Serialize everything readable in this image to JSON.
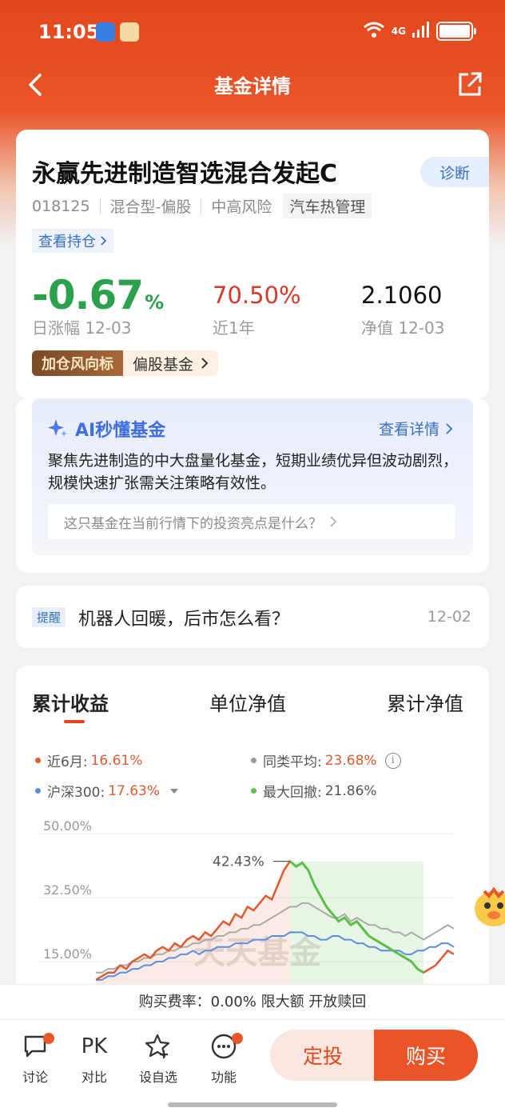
{
  "status_bar": {
    "time": "11:05",
    "network": "4G"
  },
  "nav": {
    "title": "基金详情"
  },
  "fund": {
    "name": "永赢先进制造智选混合发起C",
    "diagnose_label": "诊断",
    "code": "018125",
    "type": "混合型-偏股",
    "risk": "中高风险",
    "theme_tag": "汽车热管理",
    "holdings_link": "查看持仓",
    "daily_change": "-0.67",
    "daily_change_unit": "%",
    "daily_change_label": "日涨幅 12-03",
    "year_return": "70.50%",
    "year_return_label": "近1年",
    "nav_value": "2.1060",
    "nav_label": "净值 12-03",
    "wind_tag": "加仓风向标",
    "wind_tag_value": "偏股基金"
  },
  "ai": {
    "title": "AI秒懂基金",
    "more_label": "查看详情",
    "description": "聚焦先进制造的中大盘量化基金，短期业绩优异但波动剧烈，规模快速扩张需关注策略有效性。",
    "question": "这只基金在当前行情下的投资亮点是什么？"
  },
  "reminder": {
    "tag": "提醒",
    "text": "机器人回暖，后市怎么看？",
    "date": "12-02"
  },
  "tabs": [
    "累计收益",
    "单位净值",
    "累计净值"
  ],
  "legend": {
    "fund_label": "近6月:",
    "fund_value": "16.61%",
    "peer_label": "同类平均:",
    "peer_value": "23.68%",
    "index_label": "沪深300:",
    "index_value": "17.63%",
    "drawdown_label": "最大回撤:",
    "drawdown_value": "21.86%"
  },
  "colors": {
    "brand": "#e4471c",
    "down": "#2aa14a",
    "link": "#3970c8",
    "fund_line": "#e05a2f",
    "peer_line": "#aaaaaa",
    "index_line": "#5b8ee0",
    "drawdown": "#5cbf4a"
  },
  "chart_data": {
    "type": "line",
    "y_tick_labels": [
      "50.00%",
      "32.50%",
      "15.00%"
    ],
    "ylim": [
      15,
      50
    ],
    "peak_annotation": "42.43%",
    "watermark": "天天基金",
    "x": [
      0,
      1,
      2,
      3,
      4,
      5,
      6,
      7,
      8,
      9,
      10,
      11,
      12,
      13,
      14,
      15,
      16,
      17,
      18,
      19,
      20,
      21,
      22,
      23,
      24,
      25,
      26,
      27,
      28,
      29,
      30,
      31,
      32,
      33,
      34,
      35,
      36,
      37,
      38,
      39,
      40,
      41,
      42,
      43,
      44,
      45,
      46,
      47,
      48,
      49,
      50,
      51,
      52,
      53,
      54,
      55,
      56,
      57,
      58,
      59
    ],
    "series": [
      {
        "name": "近6月",
        "values": [
          10,
          11,
          12,
          12,
          14,
          13,
          15,
          16,
          17,
          16,
          18,
          19,
          18,
          20,
          19,
          21,
          22,
          21,
          23,
          22,
          24,
          26,
          25,
          28,
          27,
          30,
          29,
          31,
          33,
          32,
          36,
          40,
          42.43,
          41,
          42,
          40,
          36,
          33,
          30,
          28,
          26,
          27,
          25,
          26,
          24,
          22,
          21,
          20,
          19,
          18,
          17,
          16,
          15,
          13,
          12,
          13,
          14,
          16,
          18,
          17
        ]
      },
      {
        "name": "同类平均",
        "values": [
          12,
          12,
          13,
          13,
          14,
          14,
          15,
          15,
          16,
          16,
          17,
          17,
          18,
          18,
          19,
          19,
          20,
          20,
          21,
          21,
          22,
          22,
          23,
          23,
          24,
          24,
          25,
          25,
          26,
          27,
          28,
          29,
          30,
          30,
          31,
          31,
          30,
          29,
          28,
          27,
          27,
          28,
          26,
          27,
          26,
          25,
          25,
          24,
          24,
          23,
          23,
          22,
          23,
          22,
          21,
          22,
          23,
          24,
          25,
          24
        ]
      },
      {
        "name": "沪深300",
        "values": [
          10,
          10,
          11,
          11,
          12,
          12,
          13,
          13,
          14,
          14,
          15,
          15,
          16,
          16,
          17,
          17,
          18,
          17,
          18,
          18,
          19,
          19,
          19,
          20,
          20,
          20,
          21,
          21,
          21,
          22,
          22,
          22,
          23,
          23,
          23,
          22,
          22,
          21,
          21,
          22,
          22,
          21,
          21,
          20,
          20,
          19,
          19,
          18,
          18,
          18,
          18,
          17,
          17,
          18,
          18,
          19,
          19,
          20,
          20,
          19
        ]
      }
    ]
  }
}
